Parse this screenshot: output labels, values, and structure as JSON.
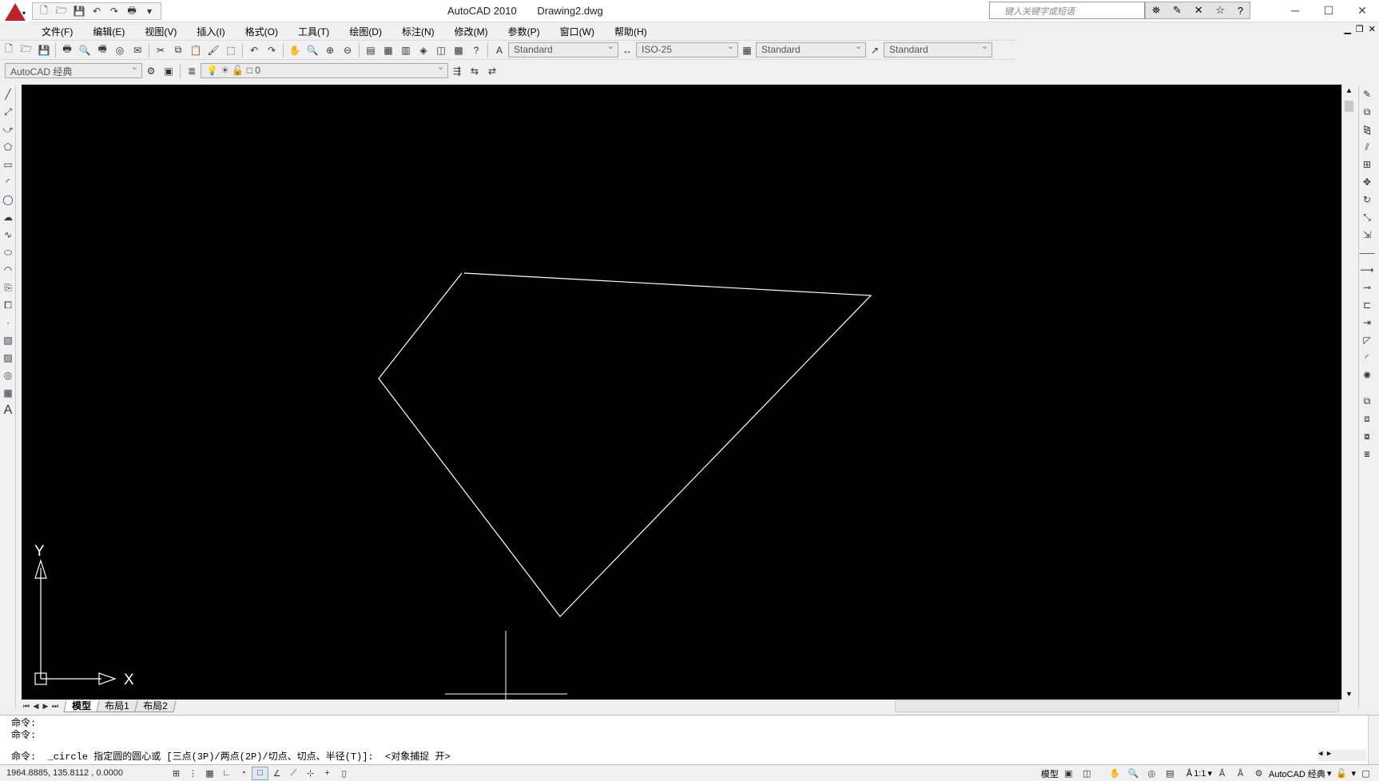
{
  "app": {
    "title": "AutoCAD 2010",
    "document": "Drawing2.dwg",
    "search_placeholder": "键入关键字或短语",
    "accent": "#c0222a"
  },
  "menu": [
    "文件(F)",
    "编辑(E)",
    "视图(V)",
    "插入(I)",
    "格式(O)",
    "工具(T)",
    "绘图(D)",
    "标注(N)",
    "修改(M)",
    "参数(P)",
    "窗口(W)",
    "帮助(H)"
  ],
  "styles": {
    "text_style": "Standard",
    "dim_style": "ISO-25",
    "table_style": "Standard",
    "multileader_style": "Standard"
  },
  "workspace": "AutoCAD 经典",
  "layer": "0",
  "drawing": {
    "background": "#000000",
    "line_color": "#ffffff",
    "polygon_points_desc": "four-sided outline drawn in white on model space",
    "ucs": {
      "x_label": "X",
      "y_label": "Y"
    }
  },
  "tabs": [
    {
      "label": "模型",
      "active": true
    },
    {
      "label": "布局1",
      "active": false
    },
    {
      "label": "布局2",
      "active": false
    }
  ],
  "command": {
    "history": [
      "命令:",
      "命令:"
    ],
    "current": "命令:  _circle 指定圆的圆心或 [三点(3P)/两点(2P)/切点、切点、半径(T)]:  <对象捕捉 开>"
  },
  "status": {
    "coordinates": "1964.8885, 135.8112 , 0.0000",
    "model_label": "模型",
    "annotation_scale": "1:1",
    "workspace_label": "AutoCAD 经典"
  }
}
